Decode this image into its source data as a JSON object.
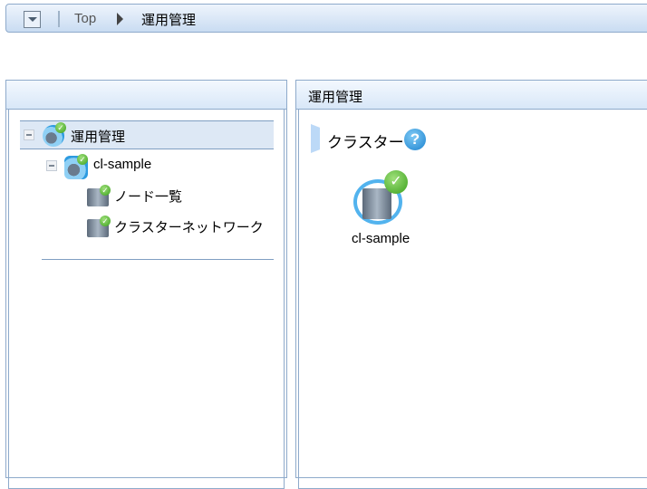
{
  "breadcrumb": {
    "items": [
      "Top",
      "運用管理"
    ]
  },
  "tree": {
    "root": "運用管理",
    "cluster": "cl-sample",
    "children": [
      "ノード一覧",
      "クラスターネットワーク"
    ]
  },
  "main": {
    "title": "運用管理",
    "section_title": "クラスター",
    "cluster_label": "cl-sample",
    "help_icon_text": "?"
  }
}
